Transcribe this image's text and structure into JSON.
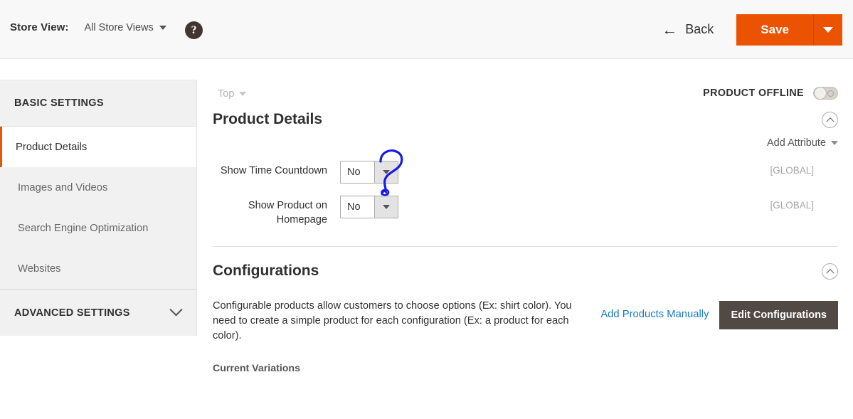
{
  "header": {
    "store_view_label": "Store View:",
    "store_view_value": "All Store Views",
    "store_view_caret_icon": "chevron-down-icon",
    "help_icon": "question-circle-icon",
    "help_glyph": "?",
    "back_label": "Back",
    "back_icon": "arrow-left-icon",
    "back_glyph": "←",
    "save_label": "Save",
    "save_toggle_icon": "caret-down-icon",
    "accent_color": "#eb5202"
  },
  "sidebar": {
    "basic_settings_title": "BASIC SETTINGS",
    "items": [
      {
        "label": "Product Details",
        "active": true
      },
      {
        "label": "Images and Videos",
        "active": false
      },
      {
        "label": "Search Engine Optimization",
        "active": false
      },
      {
        "label": "Websites",
        "active": false
      }
    ],
    "advanced_settings_title": "ADVANCED SETTINGS",
    "advanced_chevron_icon": "chevron-down-icon"
  },
  "main": {
    "top_anchor_label": "Top",
    "top_anchor_icon": "caret-down-icon",
    "product_status_label": "PRODUCT OFFLINE",
    "product_status_toggle": "off",
    "product_details": {
      "title": "Product Details",
      "collapse_icon": "chevron-up-circle-icon",
      "add_attribute_label": "Add Attribute",
      "add_attribute_icon": "caret-down-icon",
      "fields": [
        {
          "label": "Show Time Countdown",
          "value": "No",
          "scope": "[GLOBAL]",
          "dropdown_icon": "caret-down-icon"
        },
        {
          "label": "Show Product on Homepage",
          "value": "No",
          "scope": "[GLOBAL]",
          "dropdown_icon": "caret-down-icon"
        }
      ]
    },
    "configurations": {
      "title": "Configurations",
      "collapse_icon": "chevron-up-circle-icon",
      "description": "Configurable products allow customers to choose options (Ex: shirt color). You need to create a simple product for each configuration (Ex: a product for each color).",
      "add_products_link": "Add Products Manually",
      "edit_configurations_button": "Edit Configurations",
      "current_variations_label": "Current Variations",
      "link_color": "#1979c3",
      "button_color": "#514943"
    }
  },
  "annotation": {
    "type": "hand-drawn-question-mark",
    "color": "#1a1ae6"
  }
}
